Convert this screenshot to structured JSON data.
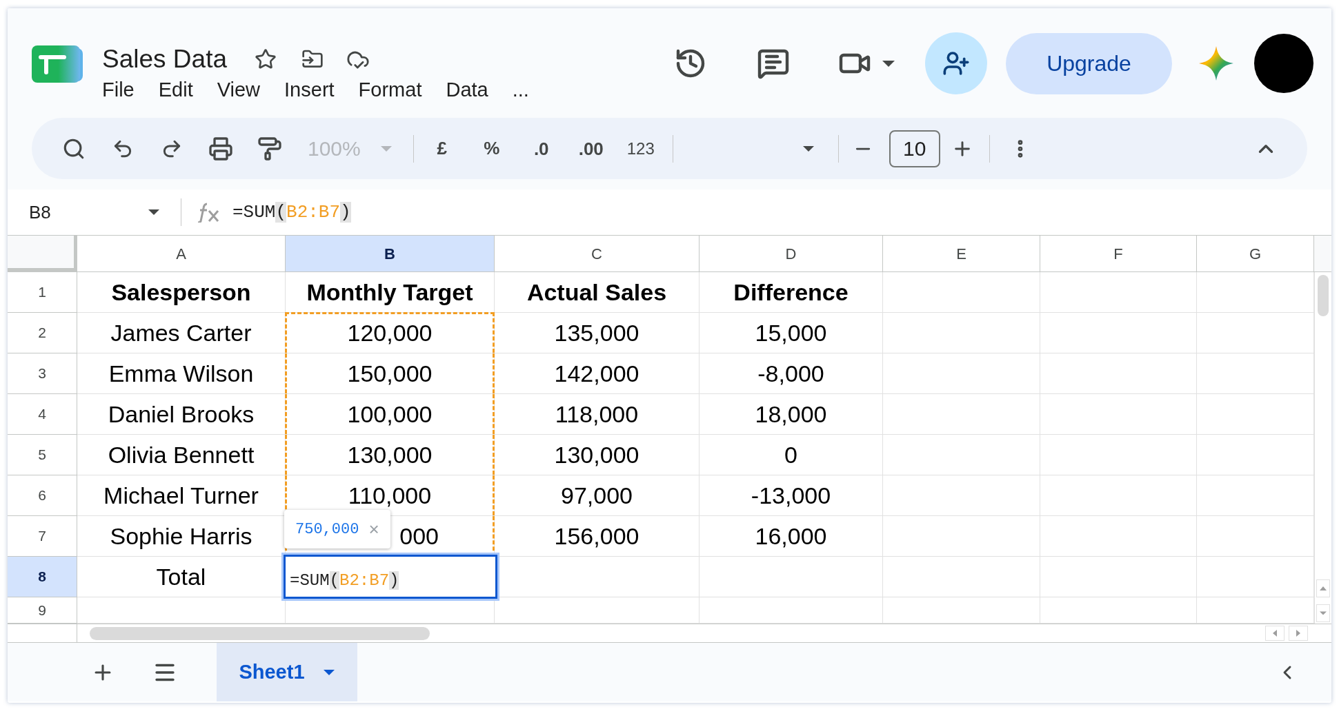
{
  "document": {
    "title": "Sales Data"
  },
  "menu": [
    "File",
    "Edit",
    "View",
    "Insert",
    "Format",
    "Data",
    "..."
  ],
  "account": {
    "upgrade": "Upgrade"
  },
  "toolbar": {
    "zoom": "100%",
    "currency": "£",
    "percent": "%",
    "decrease_decimals": ".0",
    "increase_decimals": ".00",
    "number_format": "123",
    "font_size": "10"
  },
  "formula_bar": {
    "cell_reference": "B8",
    "formula": [
      {
        "text": "=SUM",
        "kind": "plain"
      },
      {
        "text": "(",
        "kind": "paren"
      },
      {
        "text": "B2:B7",
        "kind": "range"
      },
      {
        "text": ")",
        "kind": "paren"
      }
    ]
  },
  "grid": {
    "columns": [
      {
        "label": "A",
        "selected": false
      },
      {
        "label": "B",
        "selected": true
      },
      {
        "label": "C",
        "selected": false
      },
      {
        "label": "D",
        "selected": false
      },
      {
        "label": "E",
        "selected": false
      },
      {
        "label": "F",
        "selected": false
      },
      {
        "label": "G",
        "selected": false
      }
    ],
    "rows": [
      {
        "label": "1",
        "selected": false,
        "kind": "header",
        "cells": [
          {
            "kind": "text",
            "text": "Salesperson",
            "in_range": false
          },
          {
            "kind": "text",
            "text": "Monthly Target",
            "in_range": false
          },
          {
            "kind": "text",
            "text": "Actual Sales",
            "in_range": false
          },
          {
            "kind": "text",
            "text": "Difference",
            "in_range": false
          }
        ]
      },
      {
        "label": "2",
        "selected": false,
        "kind": "data",
        "cells": [
          {
            "kind": "text",
            "text": "James Carter",
            "in_range": false
          },
          {
            "kind": "text",
            "text": "120,000",
            "in_range": true
          },
          {
            "kind": "text",
            "text": "135,000",
            "in_range": false
          },
          {
            "kind": "text",
            "text": "15,000",
            "in_range": false
          }
        ]
      },
      {
        "label": "3",
        "selected": false,
        "kind": "data",
        "cells": [
          {
            "kind": "text",
            "text": "Emma Wilson",
            "in_range": false
          },
          {
            "kind": "text",
            "text": "150,000",
            "in_range": true
          },
          {
            "kind": "text",
            "text": "142,000",
            "in_range": false
          },
          {
            "kind": "text",
            "text": "-8,000",
            "in_range": false
          }
        ]
      },
      {
        "label": "4",
        "selected": false,
        "kind": "data",
        "cells": [
          {
            "kind": "text",
            "text": "Daniel Brooks",
            "in_range": false
          },
          {
            "kind": "text",
            "text": "100,000",
            "in_range": true
          },
          {
            "kind": "text",
            "text": "118,000",
            "in_range": false
          },
          {
            "kind": "text",
            "text": "18,000",
            "in_range": false
          }
        ]
      },
      {
        "label": "5",
        "selected": false,
        "kind": "data",
        "cells": [
          {
            "kind": "text",
            "text": "Olivia Bennett",
            "in_range": false
          },
          {
            "kind": "text",
            "text": "130,000",
            "in_range": true
          },
          {
            "kind": "text",
            "text": "130,000",
            "in_range": false
          },
          {
            "kind": "text",
            "text": "0",
            "in_range": false
          }
        ]
      },
      {
        "label": "6",
        "selected": false,
        "kind": "data",
        "cells": [
          {
            "kind": "text",
            "text": "Michael Turner",
            "in_range": false
          },
          {
            "kind": "text",
            "text": "110,000",
            "in_range": true
          },
          {
            "kind": "text",
            "text": "97,000",
            "in_range": false
          },
          {
            "kind": "text",
            "text": "-13,000",
            "in_range": false
          }
        ]
      },
      {
        "label": "7",
        "selected": false,
        "kind": "data",
        "cells": [
          {
            "kind": "text",
            "text": "Sophie Harris",
            "in_range": false
          },
          {
            "kind": "covered",
            "text": "000",
            "in_range": true
          },
          {
            "kind": "text",
            "text": "156,000",
            "in_range": false
          },
          {
            "kind": "text",
            "text": "16,000",
            "in_range": false
          }
        ]
      },
      {
        "label": "8",
        "selected": true,
        "kind": "data",
        "cells": [
          {
            "kind": "text",
            "text": "Total",
            "in_range": false
          },
          {
            "kind": "editing"
          }
        ]
      },
      {
        "label": "9",
        "selected": false,
        "kind": "partial"
      }
    ],
    "editor": {
      "formula": [
        {
          "text": "=SUM",
          "kind": "plain"
        },
        {
          "text": "(",
          "kind": "paren"
        },
        {
          "text": "B2:B7",
          "kind": "range"
        },
        {
          "text": ")",
          "kind": "paren"
        }
      ],
      "preview": "750,000",
      "close": "×"
    }
  },
  "sheets": [
    {
      "label": "Sheet1",
      "selected": true
    }
  ]
}
